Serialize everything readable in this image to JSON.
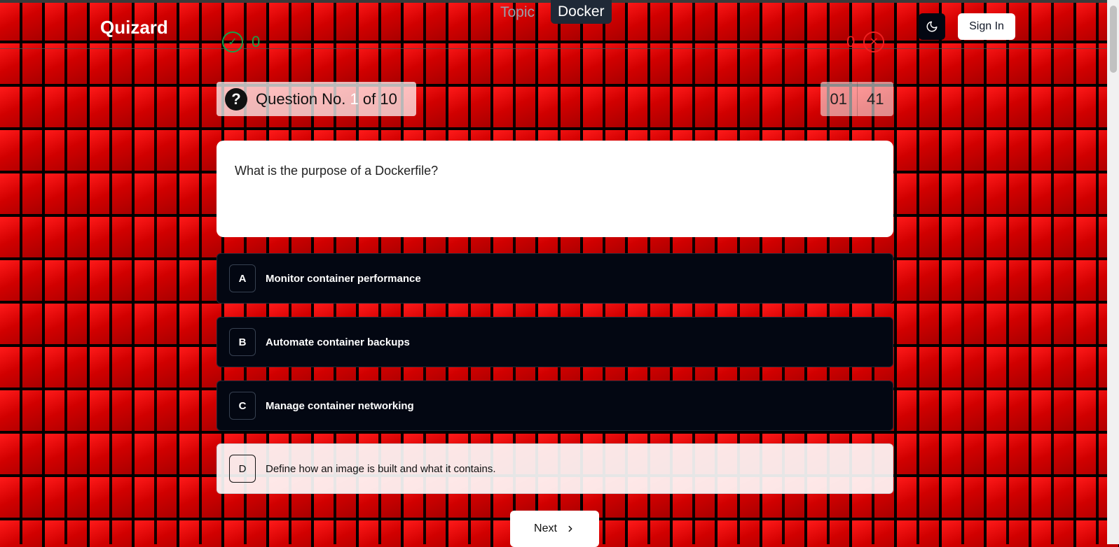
{
  "header": {
    "brand": "Quizard",
    "topic_label": "Topic",
    "topic_value": "Docker",
    "correct_count": "0",
    "wrong_count": "0",
    "signin_label": "Sign In"
  },
  "question": {
    "prefix": "Question No.",
    "current": "1",
    "suffix": "of 10",
    "text": "What is the purpose of a Dockerfile?"
  },
  "timer": {
    "minutes": "01",
    "seconds": "41"
  },
  "options": [
    {
      "letter": "A",
      "text": "Monitor container performance",
      "selected": false
    },
    {
      "letter": "B",
      "text": "Automate container backups",
      "selected": false
    },
    {
      "letter": "C",
      "text": "Manage container networking",
      "selected": false
    },
    {
      "letter": "D",
      "text": "Define how an image is built and what it contains.",
      "selected": true
    }
  ],
  "next_label": "Next",
  "icons": {
    "theme": "moon-icon",
    "correct": "check-circle-icon",
    "wrong": "x-circle-icon",
    "question": "question-circle-icon",
    "next": "chevron-right-icon"
  }
}
